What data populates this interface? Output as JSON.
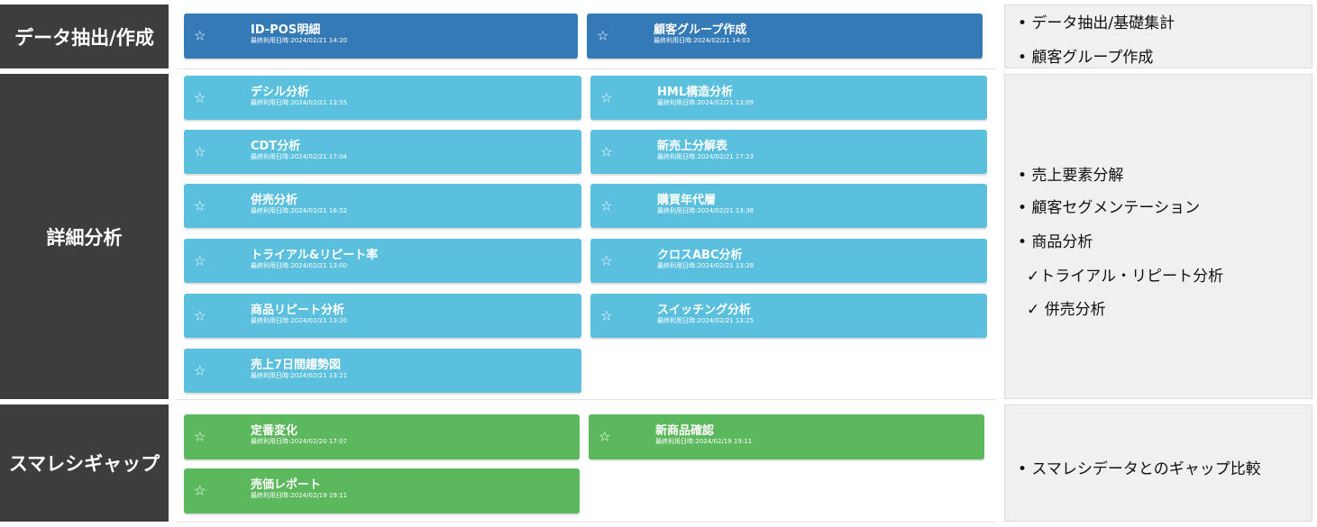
{
  "sections": {
    "extract": {
      "label": "データ抽出/作成",
      "cards": [
        {
          "star": "☆",
          "title": "ID-POS明細",
          "date": "最終利用日時:2024/02/21 14:20"
        },
        {
          "star": "☆",
          "title": "顧客グループ作成",
          "date": "最終利用日時:2024/02/21 14:03"
        }
      ],
      "notes": [
        "• データ抽出/基礎集計",
        "• 顧客グループ作成"
      ]
    },
    "detail": {
      "label": "詳細分析",
      "cards": [
        {
          "star": "☆",
          "title": "デシル分析",
          "date": "最終利用日時:2024/02/21 13:55"
        },
        {
          "star": "☆",
          "title": "HML構造分析",
          "date": "最終利用日時:2024/02/21 13:09"
        },
        {
          "star": "☆",
          "title": "CDT分析",
          "date": "最終利用日時:2024/02/21 17:04"
        },
        {
          "star": "☆",
          "title": "新売上分解表",
          "date": "最終利用日時:2024/02/21 17:23"
        },
        {
          "star": "☆",
          "title": "併売分析",
          "date": "最終利用日時:2024/02/21 16:52"
        },
        {
          "star": "☆",
          "title": "購買年代層",
          "date": "最終利用日時:2024/02/21 13:38"
        },
        {
          "star": "☆",
          "title": "トライアル&リピート率",
          "date": "最終利用日時:2024/02/21 13:00"
        },
        {
          "star": "☆",
          "title": "クロスABC分析",
          "date": "最終利用日時:2024/02/21 13:28"
        },
        {
          "star": "☆",
          "title": "商品リピート分析",
          "date": "最終利用日時:2024/02/21 13:20"
        },
        {
          "star": "☆",
          "title": "スイッチング分析",
          "date": "最終利用日時:2024/02/21 13:25"
        },
        {
          "star": "☆",
          "title": "売上7日間趨勢図",
          "date": "最終利用日時:2024/02/21 13:21"
        }
      ],
      "notes": [
        "• 売上要素分解",
        "• 顧客セグメンテーション",
        "• 商品分析",
        "✓トライアル・リピート分析",
        "✓ 併売分析"
      ]
    },
    "gap": {
      "label": "スマレシギャップ",
      "cards": [
        {
          "star": "☆",
          "title": "定番変化",
          "date": "最終利用日時:2024/02/20 17:07"
        },
        {
          "star": "☆",
          "title": "新商品確認",
          "date": "最終利用日時:2024/02/19 19:11"
        },
        {
          "star": "☆",
          "title": "売価レポート",
          "date": "最終利用日時:2024/02/19 19:11"
        }
      ],
      "notes": [
        "• スマレシデータとのギャップ比較"
      ]
    }
  },
  "colors": {
    "label_bg": "#3d3d3d",
    "card_blue": "#337ab7",
    "card_cyan": "#5bc0de",
    "card_green": "#5cb85c",
    "notes_bg": "#f0f0f0"
  }
}
